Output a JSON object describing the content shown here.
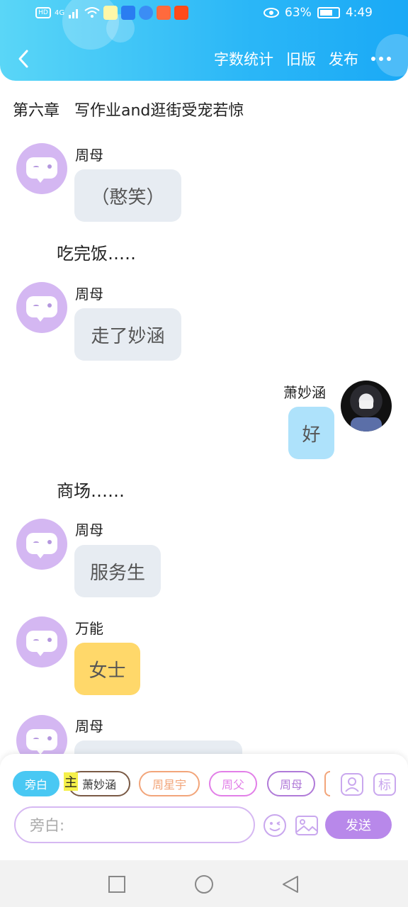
{
  "status_bar": {
    "network": "4G",
    "battery": "63%",
    "time": "4:49"
  },
  "header": {
    "actions": [
      "字数统计",
      "旧版",
      "发布"
    ]
  },
  "chapter_title": "第六章   写作业and逛街受宠若惊",
  "messages": [
    {
      "name": "周母",
      "text": "（憨笑）"
    },
    {
      "narration": "吃完饭…‥"
    },
    {
      "name": "周母",
      "text": "走了妙涵"
    },
    {
      "name": "萧妙涵",
      "text": "好"
    },
    {
      "narration": "商场……"
    },
    {
      "name": "周母",
      "text": "服务生"
    },
    {
      "name": "万能",
      "text": "女士"
    },
    {
      "name": "周母",
      "text": ""
    }
  ],
  "composer": {
    "roles": [
      "旁白",
      "萧妙涵",
      "周星宇",
      "周父",
      "周母"
    ],
    "highlight_char": "主",
    "mark_label": "标",
    "input_placeholder": "旁白:",
    "send_label": "发送"
  }
}
